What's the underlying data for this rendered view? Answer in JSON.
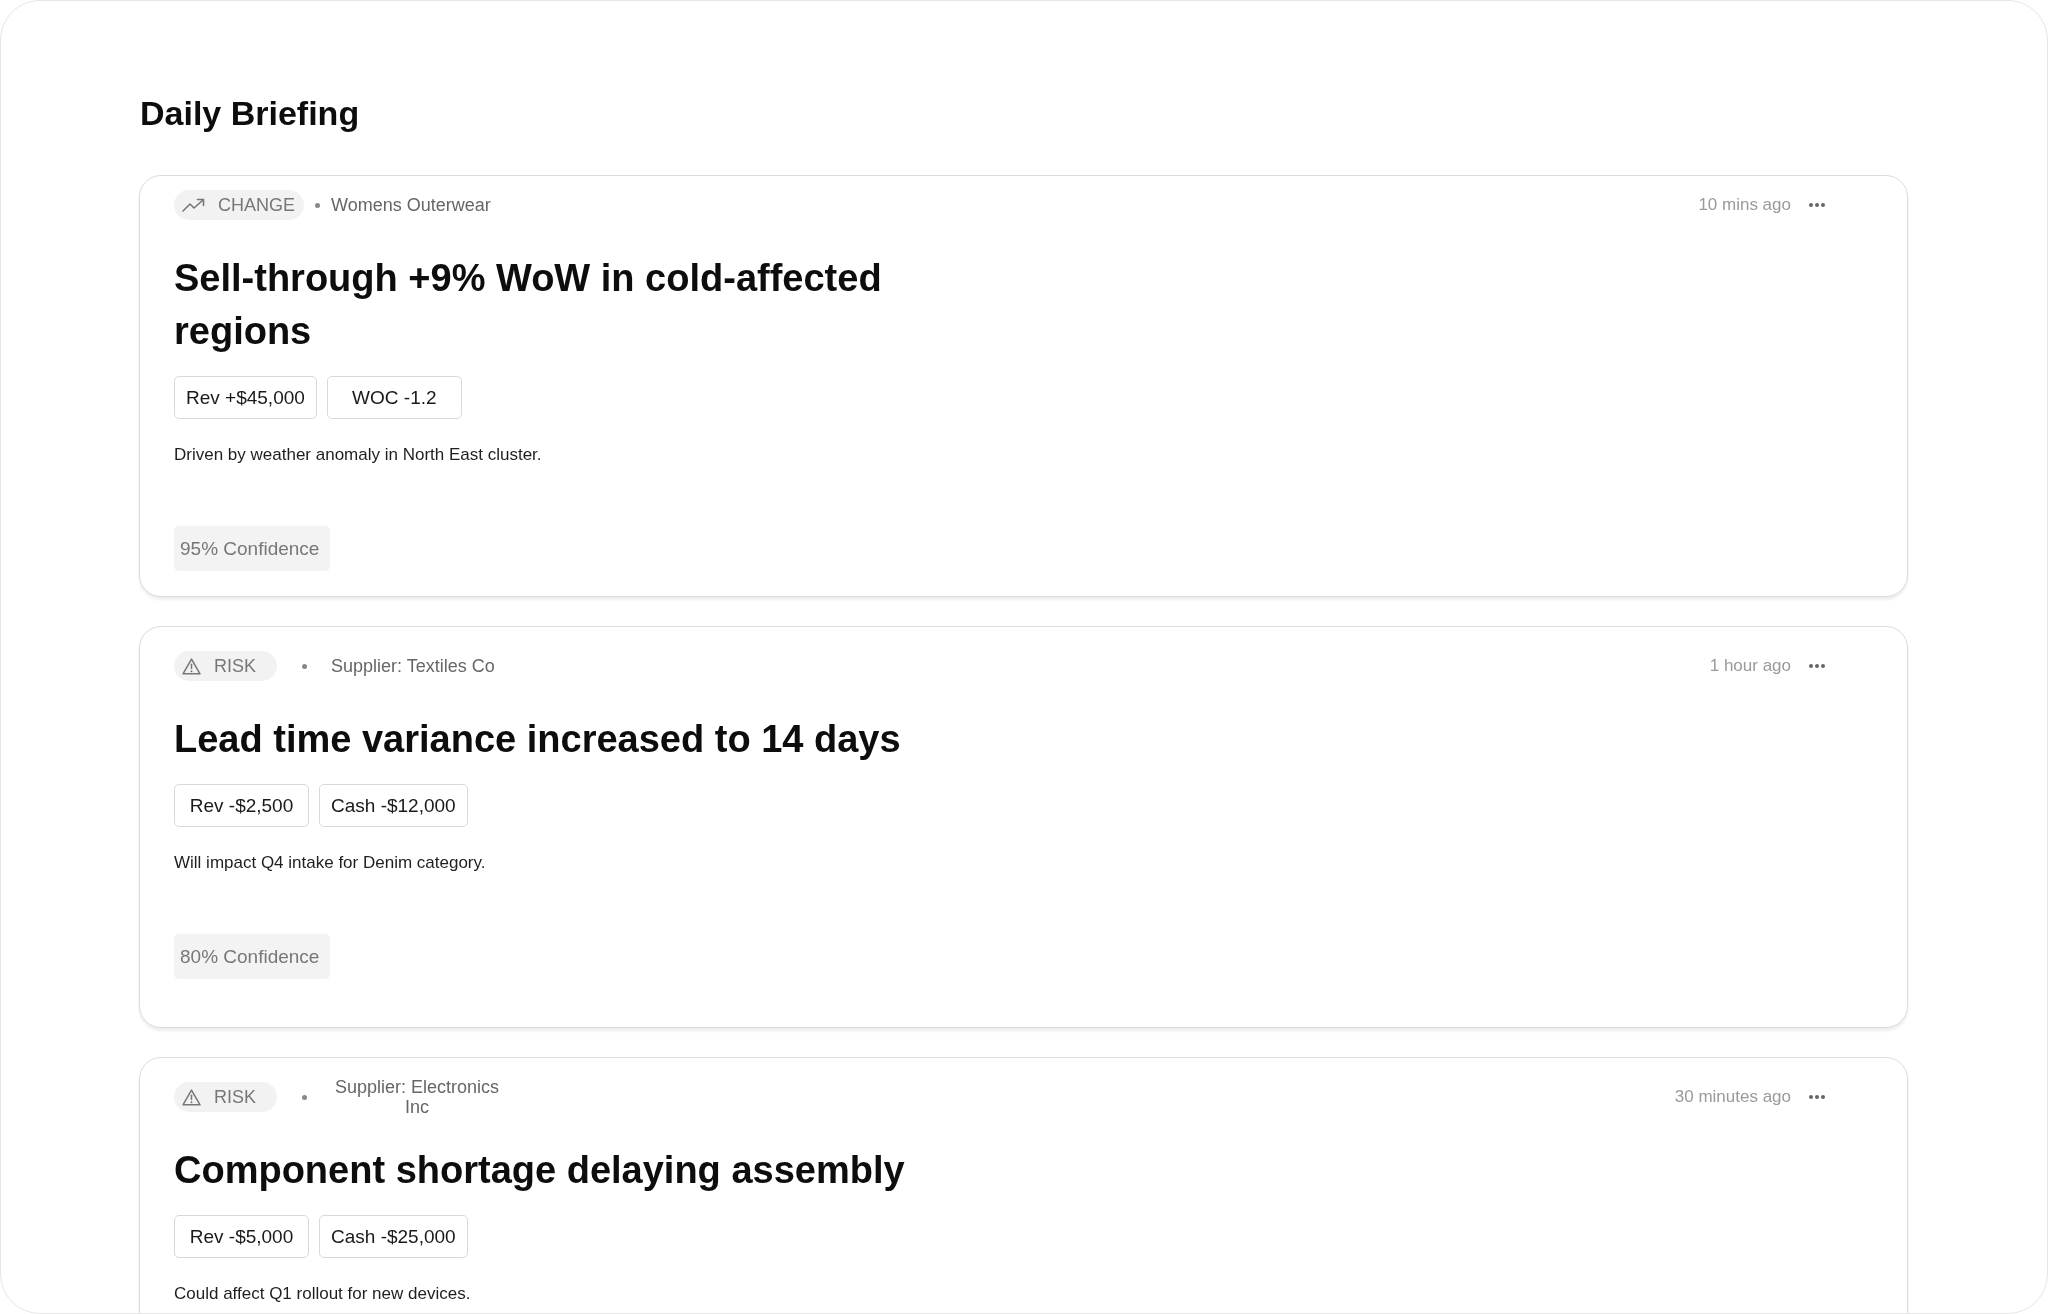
{
  "page": {
    "title": "Daily Briefing"
  },
  "cards": [
    {
      "category": {
        "kind": "change",
        "label": "CHANGE"
      },
      "source": "Womens Outerwear",
      "time": "10 mins ago",
      "title": "Sell-through +9% WoW in cold-affected regions",
      "metrics": [
        "Rev +$45,000",
        "WOC -1.2"
      ],
      "description": "Driven by weather anomaly in North East cluster.",
      "confidence": "95% Confidence"
    },
    {
      "category": {
        "kind": "risk",
        "label": "RISK"
      },
      "source": "Supplier: Textiles Co",
      "time": "1 hour ago",
      "title": "Lead time variance increased to 14 days",
      "metrics": [
        "Rev -$2,500",
        "Cash -$12,000"
      ],
      "description": "Will impact Q4 intake for Denim category.",
      "confidence": "80% Confidence"
    },
    {
      "category": {
        "kind": "risk",
        "label": "RISK"
      },
      "source": "Supplier: Electronics Inc",
      "time": "30 minutes ago",
      "title": "Component shortage delaying assembly",
      "metrics": [
        "Rev -$5,000",
        "Cash -$25,000"
      ],
      "description": "Could affect Q1 rollout for new devices."
    }
  ]
}
